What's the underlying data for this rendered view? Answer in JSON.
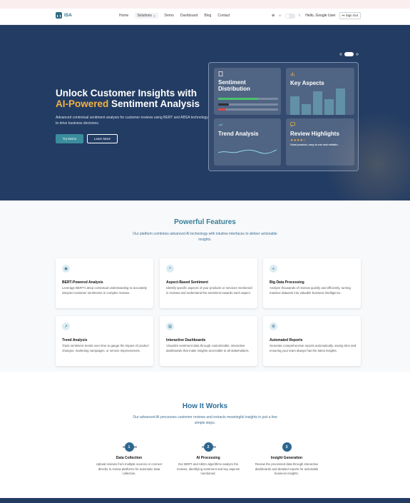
{
  "nav": {
    "logo_text": "ISA",
    "links": [
      "Home",
      "Solutions",
      "Demo",
      "Dashboard",
      "Blog",
      "Contact"
    ],
    "greeting": "Hello, Google User",
    "sign_out": "Sign Out"
  },
  "hero": {
    "title_line1": "Unlock Customer Insights with",
    "title_accent": "AI-Powered",
    "title_rest": " Sentiment Analysis",
    "description": "Advanced contextual sentiment analysis for customer reviews using BERT and ABSA technology to drive business decisions.",
    "primary_button": "Try Demo",
    "secondary_button": "Learn More",
    "cards": {
      "sentiment": "Sentiment Distribution",
      "aspects": "Key Aspects",
      "trend": "Trend Analysis",
      "highlights": "Review Highlights",
      "stars": "★★★★☆",
      "review_text": "Good product, easy to use and reliable..."
    }
  },
  "features": {
    "title": "Powerful Features",
    "subtitle": "Our platform combines advanced AI technology with intuitive interfaces to deliver actionable insights.",
    "items": [
      {
        "title": "BERT-Powered Analysis",
        "desc": "Leverage BERT's deep contextual understanding to accurately interpret customer sentiments in complex reviews.",
        "icon": "brain-icon"
      },
      {
        "title": "Aspect-Based Sentiment",
        "desc": "Identify specific aspects of your products or services mentioned in reviews and understand the sentiment towards each aspect.",
        "icon": "search-icon"
      },
      {
        "title": "Big Data Processing",
        "desc": "Analyze thousands of reviews quickly and efficiently, turning massive datasets into valuable business intelligence.",
        "icon": "database-icon"
      },
      {
        "title": "Trend Analysis",
        "desc": "Track sentiment trends over time to gauge the impact of product changes, marketing campaigns, or service improvements.",
        "icon": "trend-icon"
      },
      {
        "title": "Interactive Dashboards",
        "desc": "Visualize sentiment data through customizable, interactive dashboards that make insights accessible to all stakeholders.",
        "icon": "chart-icon"
      },
      {
        "title": "Automated Reports",
        "desc": "Generate comprehensive reports automatically, saving time and ensuring your team always has the latest insights.",
        "icon": "gear-icon"
      }
    ]
  },
  "how": {
    "title": "How It Works",
    "subtitle": "Our advanced AI processes customer reviews and extracts meaningful insights in just a few simple steps.",
    "steps": [
      {
        "num": "1",
        "title": "Data Collection",
        "desc": "Upload reviews from multiple sources or connect directly to review platforms for automatic data collection."
      },
      {
        "num": "2",
        "title": "AI Processing",
        "desc": "Our BERT and ABSA algorithms analyze the reviews, identifying sentiment and key aspects mentioned."
      },
      {
        "num": "3",
        "title": "Insight Generation",
        "desc": "Review the processed data through interactive dashboards and detailed reports for actionable business insights."
      }
    ]
  }
}
